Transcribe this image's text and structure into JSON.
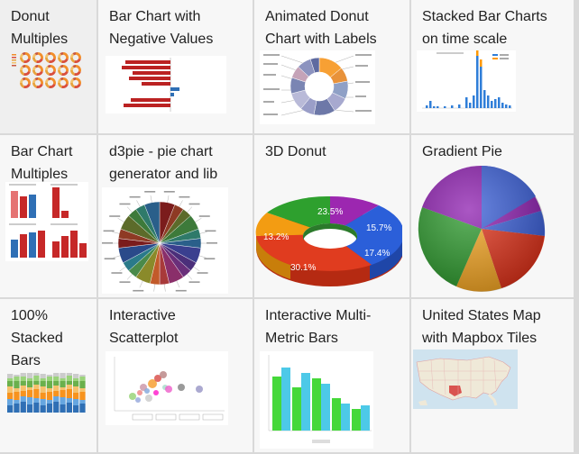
{
  "gallery": {
    "items": [
      {
        "title": "Donut Multiples"
      },
      {
        "title": "Bar Chart with Negative Values"
      },
      {
        "title": "Animated Donut Chart with Labels"
      },
      {
        "title": "Stacked Bar Charts on time scale"
      },
      {
        "title": "Bar Chart Multiples"
      },
      {
        "title": "d3pie - pie chart generator and lib"
      },
      {
        "title": "3D Donut"
      },
      {
        "title": "Gradient Pie"
      },
      {
        "title": "100% Stacked Bars"
      },
      {
        "title": "Interactive Scatterplot"
      },
      {
        "title": "Interactive Multi-Metric Bars"
      },
      {
        "title": "United States Map with Mapbox Tiles"
      }
    ]
  },
  "thumbs": {
    "donut3d": {
      "labels": [
        "23.5%",
        "15.7%",
        "13.2%",
        "17.4%",
        "30.1%"
      ],
      "colors": {
        "green": "#2ea02e",
        "purple": "#9c27b0",
        "orange": "#f39c12",
        "blue": "#2b5fd9",
        "red": "#e03c1f"
      }
    },
    "gradientPie": {
      "colors": {
        "blue": "#3a5fd8",
        "purple": "#8e1fb0",
        "red": "#e0321a",
        "orange": "#f5a623",
        "green": "#2d9a2d"
      }
    }
  }
}
